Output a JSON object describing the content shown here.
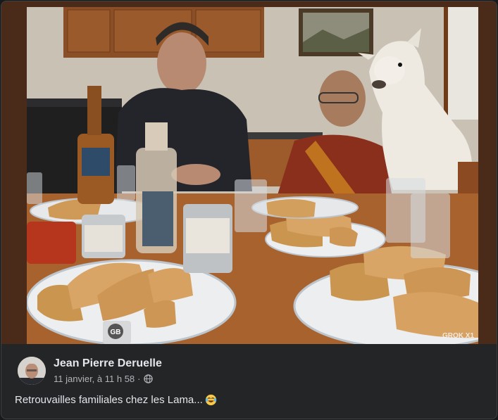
{
  "post": {
    "author_name": "Jean Pierre Deruelle",
    "timestamp": "11 janvier, à 11 h 58",
    "separator": "·",
    "privacy_icon": "globe-icon",
    "caption_text": "Retrouvailles familiales chez les Lama...",
    "caption_emoji": "laughing-tears-emoji"
  },
  "image": {
    "badge_text": "GB",
    "watermark_text": "GROK X1"
  },
  "colors": {
    "card_bg": "#242526",
    "page_bg": "#18191a",
    "primary_text": "#e4e6eb",
    "secondary_text": "#b0b3b8"
  }
}
